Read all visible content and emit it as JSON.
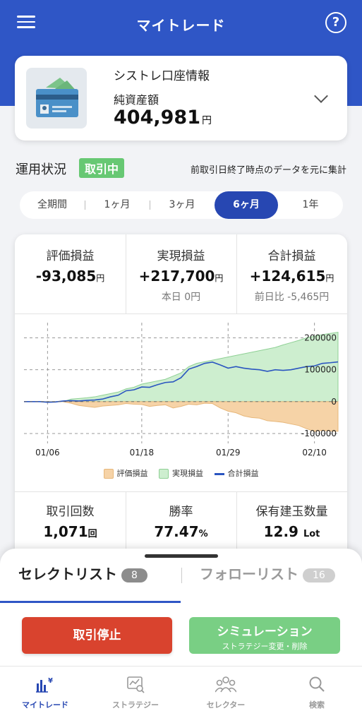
{
  "header": {
    "title": "マイトレード",
    "help_label": "?"
  },
  "account": {
    "name": "シストレ口座情報",
    "net_assets_label": "純資産額",
    "net_assets_value": "404,981",
    "unit": "円"
  },
  "status": {
    "label": "運用状況",
    "badge": "取引中",
    "note": "前取引日終了時点のデータを元に集計"
  },
  "period_tabs": [
    "全期間",
    "1ヶ月",
    "3ヶ月",
    "6ヶ月",
    "1年"
  ],
  "active_period": "6ヶ月",
  "stats": {
    "unrealized": {
      "label": "評価損益",
      "value": "-93,085",
      "unit": "円"
    },
    "realized": {
      "label": "実現損益",
      "value": "+217,700",
      "unit": "円",
      "sub": "本日 0円"
    },
    "total": {
      "label": "合計損益",
      "value": "+124,615",
      "unit": "円",
      "sub": "前日比 -5,465円"
    }
  },
  "colors": {
    "header_bg": "#2f56c6",
    "active_tab": "#2747b2",
    "badge_green": "#67c873",
    "unrealized_fill": "#f6d3a7",
    "realized_fill": "#cdeecf",
    "total_line": "#2a55c0",
    "stop_button": "#d9432e",
    "sim_button": "#79cf84"
  },
  "chart_data": {
    "type": "area",
    "x_tick_labels": [
      "01/06",
      "01/18",
      "01/29",
      "02/10"
    ],
    "y_tick_labels": [
      "200000",
      "100000",
      "0",
      "-100000"
    ],
    "ylim": [
      -120000,
      230000
    ],
    "grid": true,
    "legend_position": "bottom",
    "x": [
      0,
      1,
      2,
      3,
      4,
      5,
      6,
      7,
      8,
      9,
      10,
      11,
      12,
      13,
      14,
      15,
      16,
      17,
      18,
      19,
      20,
      21,
      22,
      23,
      24,
      25,
      26,
      27,
      28,
      29,
      30,
      31,
      32,
      33,
      34,
      35,
      36,
      37,
      38,
      39,
      40
    ],
    "series": [
      {
        "name": "評価損益",
        "values": [
          0,
          0,
          0,
          0,
          0,
          0,
          -5000,
          -12000,
          -15000,
          -18000,
          -14000,
          -12000,
          -10000,
          -6000,
          -8000,
          -9000,
          -15000,
          -12000,
          -10000,
          -20000,
          -15000,
          -8000,
          -10000,
          -5000,
          -6000,
          -20000,
          -30000,
          -35000,
          -45000,
          -50000,
          -52000,
          -60000,
          -62000,
          -65000,
          -70000,
          -75000,
          -85000,
          -93085,
          -90000,
          -92000,
          -93085
        ]
      },
      {
        "name": "実現損益",
        "values": [
          0,
          0,
          0,
          0,
          0,
          0,
          8000,
          10000,
          12000,
          15000,
          20000,
          25000,
          30000,
          40000,
          45000,
          55000,
          60000,
          65000,
          70000,
          80000,
          90000,
          110000,
          120000,
          125000,
          130000,
          135000,
          140000,
          145000,
          150000,
          155000,
          160000,
          165000,
          170000,
          178000,
          185000,
          192000,
          200000,
          205000,
          210000,
          214000,
          217700
        ]
      },
      {
        "name": "合計損益",
        "values": [
          0,
          0,
          0,
          -2000,
          -1000,
          2000,
          3000,
          2000,
          4000,
          5000,
          8000,
          15000,
          20000,
          34000,
          37000,
          46000,
          45000,
          53000,
          60000,
          62000,
          75000,
          102000,
          110000,
          120000,
          124000,
          115000,
          105000,
          110000,
          105000,
          102000,
          100000,
          95000,
          100000,
          98000,
          100000,
          105000,
          110000,
          112000,
          120000,
          122000,
          124615
        ]
      }
    ]
  },
  "legend": {
    "unrealized": "評価損益",
    "realized": "実現損益",
    "total": "合計損益"
  },
  "stats2": {
    "trades": {
      "label": "取引回数",
      "value": "1,071",
      "unit": "回"
    },
    "win_rate": {
      "label": "勝率",
      "value": "77.47",
      "unit": "%"
    },
    "positions": {
      "label": "保有建玉数量",
      "value": "12.9",
      "unit": "Lot"
    }
  },
  "list_tabs": {
    "select": {
      "label": "セレクトリスト",
      "count": "8"
    },
    "follow": {
      "label": "フォローリスト",
      "count": "16"
    }
  },
  "buttons": {
    "stop": "取引停止",
    "simulation": "シミュレーション",
    "simulation_sub": "ストラテジー変更・削除"
  },
  "nav": {
    "mytrade": "マイトレード",
    "strategy": "ストラテジー",
    "selector": "セレクター",
    "search": "検索"
  }
}
